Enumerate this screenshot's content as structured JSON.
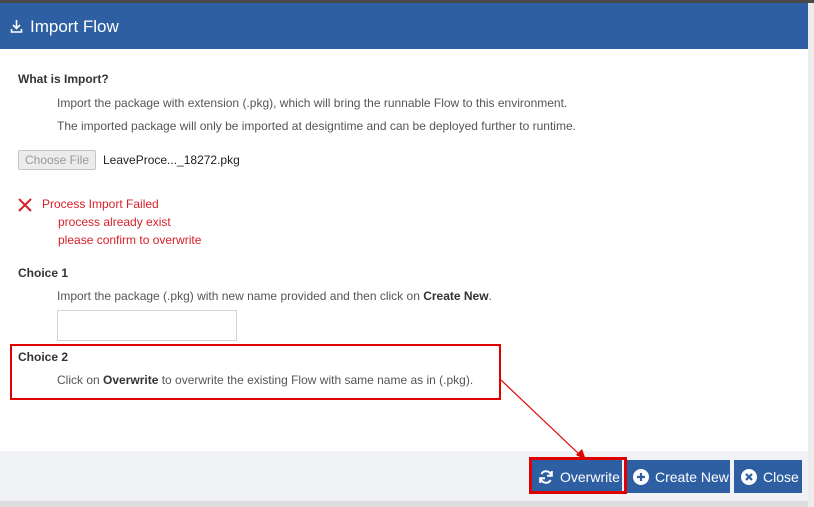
{
  "dialog": {
    "title": "Import Flow",
    "icon": "download-icon"
  },
  "what_is_import": {
    "heading": "What is Import?",
    "line1": "Import the package with extension (.pkg), which will bring the runnable Flow to this environment.",
    "line2": "The imported package will only be imported at designtime and can be deployed further to runtime."
  },
  "file": {
    "choose_label": "Choose File",
    "filename": "LeaveProce..._18272.pkg"
  },
  "error": {
    "icon": "error-x-icon",
    "title": "Process Import Failed",
    "line1": "process already exist",
    "line2": "please confirm to overwrite",
    "color": "#d8202a"
  },
  "choice1": {
    "heading": "Choice 1",
    "text_before": "Import the package (.pkg) with new name provided and then click on ",
    "text_bold": "Create New",
    "text_after": ".",
    "input_value": ""
  },
  "choice2": {
    "heading": "Choice 2",
    "text_before": "Click on ",
    "text_bold": "Overwrite",
    "text_after": " to overwrite the existing Flow with same name as in (.pkg)."
  },
  "buttons": {
    "overwrite": "Overwrite",
    "create_new": "Create New",
    "close": "Close"
  },
  "colors": {
    "primary": "#2e5fa3",
    "annotation": "#e00000"
  }
}
